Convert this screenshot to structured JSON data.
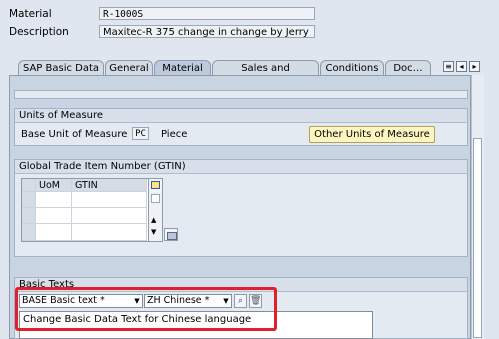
{
  "header": {
    "material_label": "Material",
    "material_value": "R-1000S",
    "description_label": "Description",
    "description_value": "Maxitec-R 375 change in change by Jerry"
  },
  "tabs": [
    {
      "label": "SAP Basic Data"
    },
    {
      "label": "General"
    },
    {
      "label": "Material"
    },
    {
      "label": "Sales and Distribution"
    },
    {
      "label": "Conditions"
    },
    {
      "label": "Doc…"
    }
  ],
  "active_tab": "Material",
  "nav": {
    "list_icon": "list-icon",
    "prev_icon": "prev-icon",
    "next_icon": "next-icon"
  },
  "units": {
    "title": "Units of Measure",
    "base_label": "Base Unit of Measure",
    "base_code": "PC",
    "base_text": "Piece",
    "other_button": "Other Units of Measure"
  },
  "gtin": {
    "title": "Global Trade Item Number (GTIN)",
    "columns": [
      "UoM",
      "GTIN"
    ]
  },
  "basic_texts": {
    "title": "Basic Texts",
    "text_type": "BASE Basic text *",
    "language": "ZH Chinese *",
    "content": "Change Basic Data Text for Chinese language"
  },
  "colors": {
    "highlight": "#e0202c",
    "button_bg": "#fef6c0"
  }
}
